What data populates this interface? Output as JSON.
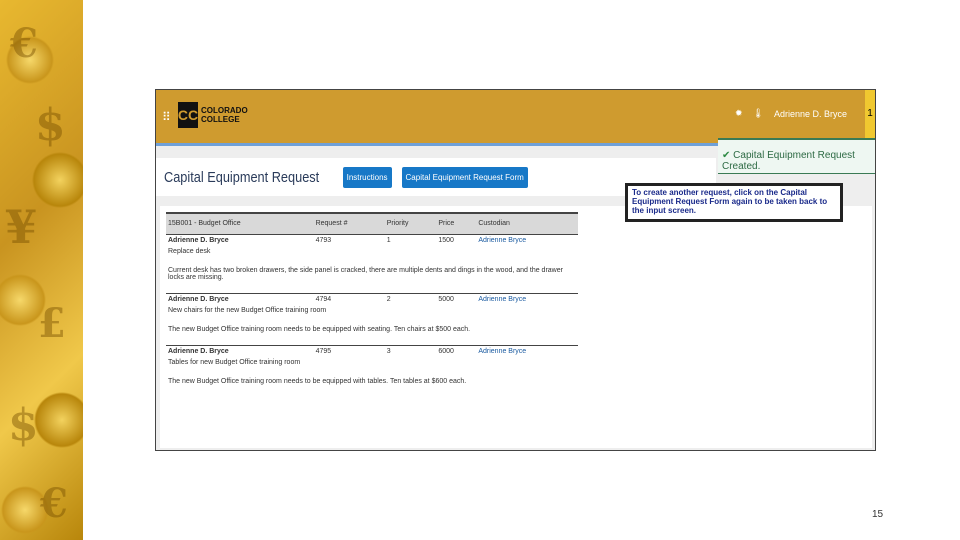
{
  "app": {
    "logo_text": [
      "COLORADO",
      "COLLEGE"
    ],
    "user": "Adrienne D. Bryce",
    "notification_count": "1"
  },
  "toast": "Capital Equipment Request Created.",
  "page": {
    "title": "Capital Equipment Request",
    "buttons": [
      "Instructions",
      "Capital Equipment Request Form"
    ]
  },
  "callout": "To create another request, click on the Capital Equipment Request Form again to be taken back to the input screen.",
  "table": {
    "group": "15B001 - Budget Office",
    "columns": [
      "Request #",
      "Priority",
      "Price",
      "Custodian"
    ],
    "rows": [
      {
        "requester": "Adrienne D. Bryce",
        "title": "Replace desk",
        "request": "4793",
        "priority": "1",
        "price": "1500",
        "custodian": "Adrienne Bryce",
        "description": "Current desk has two broken drawers, the side panel is cracked, there are multiple dents and dings in the wood, and the drawer locks are missing."
      },
      {
        "requester": "Adrienne D. Bryce",
        "title": "New chairs for the new Budget Office training room",
        "request": "4794",
        "priority": "2",
        "price": "5000",
        "custodian": "Adrienne Bryce",
        "description": "The new Budget Office training room needs to be equipped with seating. Ten chairs at $500 each."
      },
      {
        "requester": "Adrienne D. Bryce",
        "title": "Tables for new Budget Office training room",
        "request": "4795",
        "priority": "3",
        "price": "6000",
        "custodian": "Adrienne Bryce",
        "description": "The new Budget Office training room needs to be equipped with tables. Ten tables at $600 each."
      }
    ]
  },
  "slide_number": "15"
}
